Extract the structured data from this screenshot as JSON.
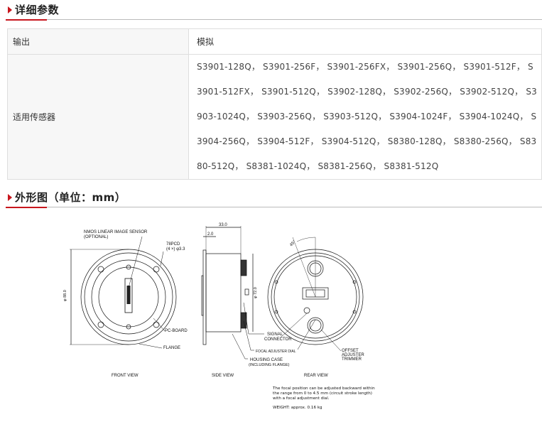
{
  "sections": {
    "params_title": "详细参数",
    "outline_title": "外形图（单位：mm）"
  },
  "params": [
    {
      "key": "输出",
      "value": "模拟"
    },
    {
      "key": "适用传感器",
      "value": "S3901-128Q， S3901-256F， S3901-256FX， S3901-256Q， S3901-512F， S3901-512FX， S3901-512Q， S3902-128Q， S3902-256Q， S3902-512Q， S3903-1024Q， S3903-256Q， S3903-512Q， S3904-1024F， S3904-1024Q， S3904-256Q， S3904-512F， S3904-512Q， S8380-128Q， S8380-256Q， S8380-512Q， S8381-1024Q， S8381-256Q， S8381-512Q"
    }
  ],
  "drawing": {
    "labels": {
      "nmos": "NMOS LINEAR IMAGE SENSOR",
      "optional": "(OPTIONAL)",
      "pcd": "78PCD",
      "holes": "(4 ×) φ3.3",
      "pcboard": "PC-BOARD",
      "flange": "FLANGE",
      "dim_33": "33.0",
      "dim_2": "2.0",
      "dim_88": "φ 88.0",
      "dim_72": "φ 72.0",
      "angle": "45°",
      "signal1": "SIGNAL",
      "signal2": "CONNECTOR",
      "focal": "FOCAL ADJUSTER DIAL",
      "housing1": "HOUSING CASE",
      "housing2": "(INCLUDING FLANGE)",
      "offset1": "OFFSET",
      "offset2": "ADJUSTER",
      "offset3": "TRIMMER",
      "front": "FRONT VIEW",
      "side": "SIDE VIEW",
      "rear": "REAR VIEW"
    },
    "note": "The focal position can be adjusted backward within the range from 0 to 4.5 mm (circuit stroke length) with a focal adjustment dial.",
    "weight": "WEIGHT: approx. 0.16 kg"
  },
  "colors": {
    "accent": "#c8161d",
    "rule": "#bbbbbb",
    "table_border": "#dedede",
    "key_bg": "#f7f7f7"
  }
}
